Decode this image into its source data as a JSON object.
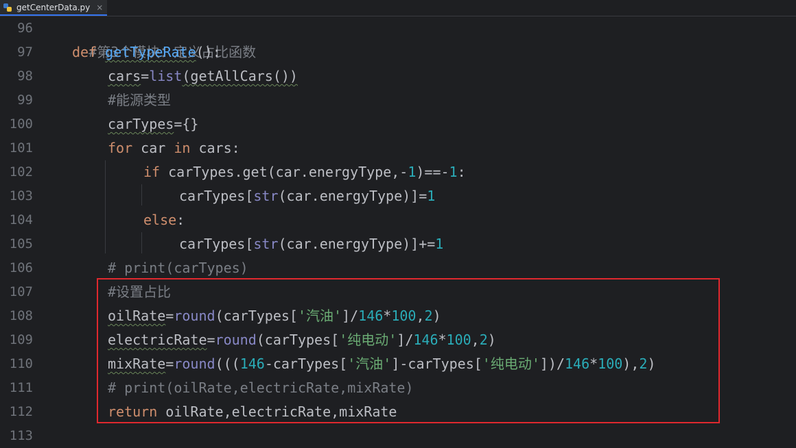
{
  "tab": {
    "filename": "getCenterData.py",
    "close": "×"
  },
  "line_numbers": [
    "96",
    "97",
    "98",
    "99",
    "100",
    "101",
    "102",
    "103",
    "104",
    "105",
    "106",
    "107",
    "108",
    "109",
    "110",
    "111",
    "112",
    "113"
  ],
  "code": {
    "l96": {
      "comment": "#第3个模块：定义占比函数"
    },
    "l97": {
      "kw": "def",
      "fn": "getTypeRate",
      "rest": "():"
    },
    "l98": {
      "var": "cars",
      "eq": "=",
      "bi": "list",
      "rest": "(getAllCars())"
    },
    "l99": {
      "comment": "#能源类型"
    },
    "l100": {
      "var": "carTypes",
      "rest": "={}"
    },
    "l101": {
      "kw1": "for",
      "mid1": " car ",
      "kw2": "in",
      "mid2": " cars:"
    },
    "l102": {
      "kw": "if",
      "a": " carTypes.get(car.energyType,-",
      "n1": "1",
      "b": ")==-",
      "n2": "1",
      "c": ":"
    },
    "l103": {
      "a": "carTypes[",
      "bi": "str",
      "b": "(car.energyType)]=",
      "n": "1"
    },
    "l104": {
      "kw": "else",
      "rest": ":"
    },
    "l105": {
      "a": "carTypes[",
      "bi": "str",
      "b": "(car.energyType)]+=",
      "n": "1"
    },
    "l106": {
      "comment": "# print(carTypes)"
    },
    "l107": {
      "comment": "#设置占比"
    },
    "l108": {
      "var": "oilRate",
      "eq": "=",
      "bi": "round",
      "a": "(carTypes[",
      "s": "'汽油'",
      "b": "]/",
      "n1": "146",
      "c": "*",
      "n2": "100",
      "d": ",",
      "n3": "2",
      "e": ")"
    },
    "l109": {
      "var": "electricRate",
      "eq": "=",
      "bi": "round",
      "a": "(carTypes[",
      "s": "'纯电动'",
      "b": "]/",
      "n1": "146",
      "c": "*",
      "n2": "100",
      "d": ",",
      "n3": "2",
      "e": ")"
    },
    "l110": {
      "var": "mixRate",
      "eq": "=",
      "bi": "round",
      "a": "(((",
      "n1": "146",
      "b": "-carTypes[",
      "s1": "'汽油'",
      "c": "]-carTypes[",
      "s2": "'纯电动'",
      "d": "])/",
      "n2": "146",
      "e": "*",
      "n3": "100",
      "f": "),",
      "n4": "2",
      "g": ")"
    },
    "l111": {
      "comment": "# print(oilRate,electricRate,mixRate)"
    },
    "l112": {
      "kw": "return",
      "rest": " oilRate,electricRate,mixRate"
    }
  },
  "colors": {
    "highlight_box": "#e0282e",
    "keyword": "#cf8e6d",
    "function": "#56a8f5",
    "number": "#2aacb8",
    "string": "#6aab73",
    "comment": "#7a7e85"
  }
}
